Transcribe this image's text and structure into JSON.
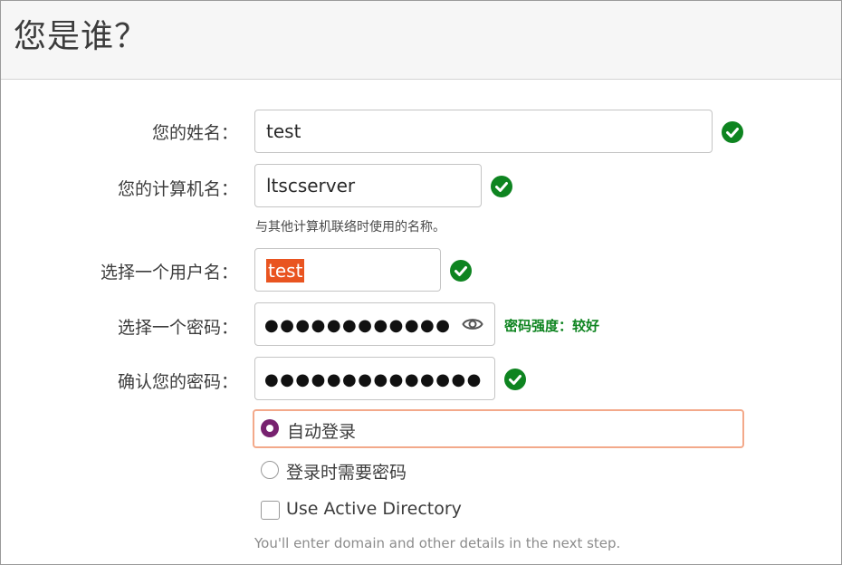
{
  "header": {
    "title": "您是谁？"
  },
  "form": {
    "name": {
      "label": "您的姓名：",
      "value": "test"
    },
    "computer_name": {
      "label": "您的计算机名：",
      "value": "ltscserver",
      "hint": "与其他计算机联络时使用的名称。"
    },
    "username": {
      "label": "选择一个用户名：",
      "value": "test"
    },
    "password": {
      "label": "选择一个密码：",
      "masked": "●●●●●●●●●●●●",
      "strength": "密码强度：较好"
    },
    "confirm_password": {
      "label": "确认您的密码：",
      "masked": "●●●●●●●●●●●●●●"
    }
  },
  "login_options": {
    "auto_login": {
      "label": "自动登录",
      "selected": true
    },
    "require_password": {
      "label": "登录时需要密码",
      "selected": false
    }
  },
  "active_directory": {
    "label": "Use Active Directory",
    "checked": false,
    "note": "You'll enter domain and other details in the next step."
  },
  "icons": {
    "valid": "check-circle-icon",
    "reveal": "eye-icon"
  },
  "colors": {
    "valid": "#0e8420",
    "selection": "#e95420",
    "radio": "#77216f",
    "focus": "#f3a98a"
  }
}
